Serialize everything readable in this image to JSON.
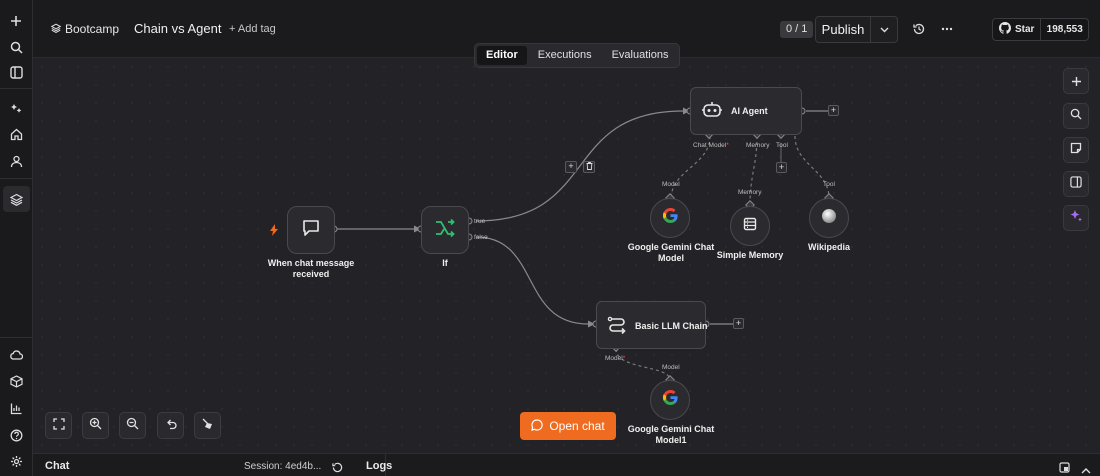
{
  "header": {
    "breadcrumb": "Bootcamp",
    "workflow_title": "Chain vs Agent",
    "add_tag": "+ Add tag",
    "counter": "0 / 1",
    "publish_label": "Publish",
    "github_star_label": "Star",
    "github_star_count": "198,553"
  },
  "tabs": [
    {
      "label": "Editor",
      "active": true
    },
    {
      "label": "Executions",
      "active": false
    },
    {
      "label": "Evaluations",
      "active": false
    }
  ],
  "nodes": {
    "trigger": {
      "label_line1": "When chat message",
      "label_line2": "received"
    },
    "if_node": {
      "label": "If",
      "true_label": "true",
      "false_label": "false"
    },
    "agent": {
      "label": "AI Agent",
      "port_chat_model": "Chat Model",
      "port_memory": "Memory",
      "port_tool": "Tool"
    },
    "gemini1": {
      "label_line1": "Google Gemini Chat",
      "label_line2": "Model",
      "conn_label": "Model"
    },
    "memory": {
      "label": "Simple Memory",
      "conn_label": "Memory"
    },
    "wikipedia": {
      "label": "Wikipedia",
      "conn_label": "Tool"
    },
    "chain": {
      "label": "Basic LLM Chain",
      "port_model": "Model"
    },
    "gemini2": {
      "label_line1": "Google Gemini Chat",
      "label_line2": "Model1",
      "conn_label": "Model"
    }
  },
  "open_chat_label": "Open chat",
  "bottom": {
    "chat_label": "Chat",
    "session_label": "Session: 4ed4b...",
    "logs_label": "Logs"
  },
  "colors": {
    "accent_orange": "#ef6b1f",
    "if_green": "#2fbf71",
    "required_red": "#ff4d4d",
    "sparkle_purple": "#a96cf6"
  }
}
